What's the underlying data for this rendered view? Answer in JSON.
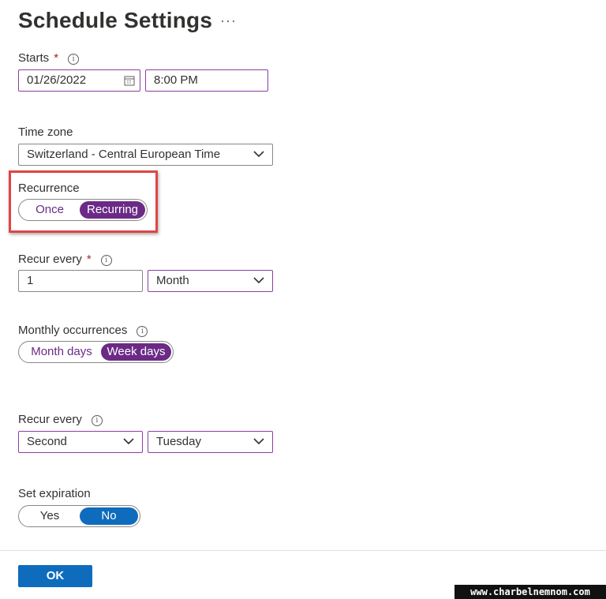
{
  "header": {
    "title": "Schedule Settings",
    "more_glyph": "···"
  },
  "starts": {
    "label": "Starts",
    "required_mark": "*",
    "date_value": "01/26/2022",
    "time_value": "8:00 PM",
    "icon": "calendar-icon"
  },
  "time_zone": {
    "label": "Time zone",
    "value": "Switzerland - Central European Time"
  },
  "recurrence": {
    "label": "Recurrence",
    "options": [
      "Once",
      "Recurring"
    ],
    "selected": "Recurring",
    "highlight_color": "#e04545"
  },
  "recur_every_1": {
    "label": "Recur every",
    "required_mark": "*",
    "interval_value": "1",
    "unit_value": "Month"
  },
  "monthly_occurrences": {
    "label": "Monthly occurrences",
    "options": [
      "Month days",
      "Week days"
    ],
    "selected": "Week days"
  },
  "recur_every_2": {
    "label": "Recur every",
    "ordinal_value": "Second",
    "day_value": "Tuesday"
  },
  "expiration": {
    "label": "Set expiration",
    "options": [
      "Yes",
      "No"
    ],
    "selected": "No"
  },
  "footer": {
    "ok_label": "OK"
  },
  "watermark": "www.charbelnemnom.com",
  "colors": {
    "accent_purple": "#6b2a86",
    "field_border": "#8a3fa3",
    "primary_blue": "#0f6cbd",
    "required_red": "#a4262c"
  }
}
